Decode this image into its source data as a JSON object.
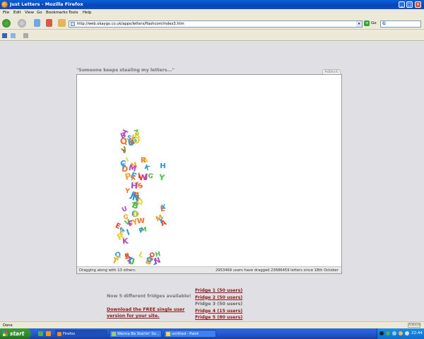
{
  "window": {
    "title": "Just Letters - Mozilla Firefox"
  },
  "menu": [
    "File",
    "Edit",
    "View",
    "Go",
    "Bookmarks",
    "Tools",
    "Help"
  ],
  "nav": {
    "url": "http://web.okaygo.co.uk/apps/letters/flashcom/index3.htm",
    "go_label": "Go",
    "search_placeholder": ""
  },
  "page": {
    "heading": "\"Someone keeps stealing my letters...\"",
    "adblock_tab": "Adblock",
    "status_left": "Dragging along with 13 others.",
    "status_right": "2953469 users have dragged 23686459 letters since 18th October",
    "promo": "Now 5 different fridges available!",
    "download_link": "Download the FREE single user version for your site.",
    "fridges": [
      {
        "label": "Fridge 1 (50 users)",
        "current": false
      },
      {
        "label": "Fridge 2 (50 users)",
        "current": false
      },
      {
        "label": "Fridge 3 (50 users)",
        "current": true
      },
      {
        "label": "Fridge 4 (15 users)",
        "current": false
      },
      {
        "label": "Fridge 5 (80 users)",
        "current": false
      }
    ],
    "letter_colors": [
      "#e6452b",
      "#f2a12a",
      "#3a9be0",
      "#4dbb4a",
      "#e8d230",
      "#b24ac9",
      "#e8732b",
      "#2b8fd6"
    ],
    "letter_glyphs": [
      "R",
      "F",
      "S",
      "Z",
      "R",
      "T",
      "Q",
      "U",
      "Y",
      "J",
      "S",
      "J",
      "O",
      "B",
      "D",
      "H",
      "L",
      "N",
      "E",
      "Y",
      "A",
      "M",
      "X",
      "K",
      "W",
      "P",
      "C",
      "G",
      "I",
      "V"
    ]
  },
  "statusbar": {
    "text": "Done",
    "adblock": "Adblock"
  },
  "taskbar": {
    "start_label": "start",
    "tasks": [
      {
        "label": "Firefox",
        "active": true
      },
      {
        "label": "Wanna Be Startin' So...",
        "active": false
      },
      {
        "label": "untitled - Paint",
        "active": false
      }
    ],
    "clock": "22:44"
  }
}
